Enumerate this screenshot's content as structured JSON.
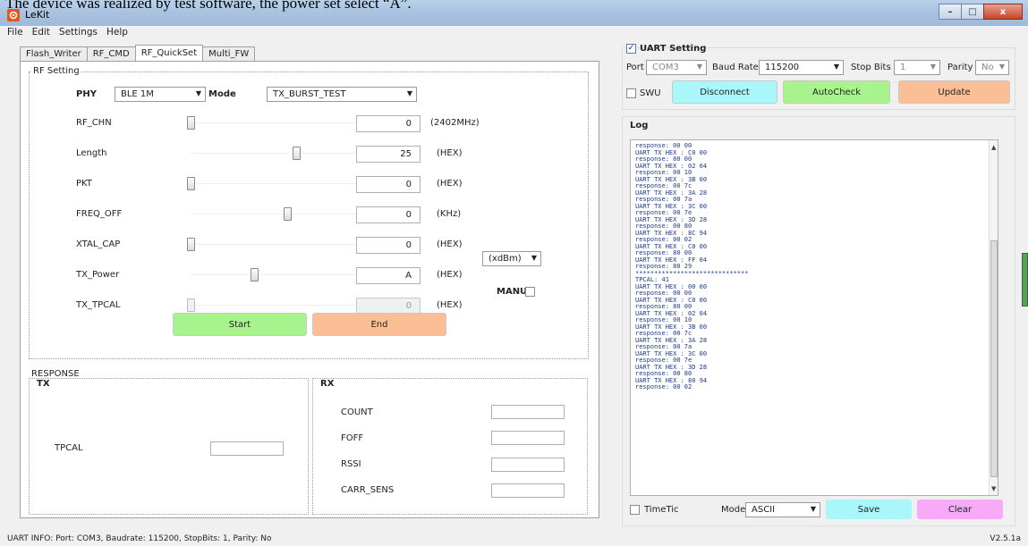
{
  "caption": "The device was realized by test software, the power set select “A”.",
  "window": {
    "title": "LeKit",
    "controls": [
      "–",
      "□",
      "x"
    ]
  },
  "menu": [
    "File",
    "Edit",
    "Settings",
    "Help"
  ],
  "tabs": [
    "Flash_Writer",
    "RF_CMD",
    "RF_QuickSet",
    "Multi_FW"
  ],
  "active_tab": "RF_QuickSet",
  "rf_setting": {
    "title": "RF Setting",
    "phy_label": "PHY",
    "phy_value": "BLE 1M",
    "mode_label": "Mode",
    "mode_value": "TX_BURST_TEST",
    "rows": [
      {
        "label": "RF_CHN",
        "value": "0",
        "unit": "(2402MHz)",
        "slider_fraction": 0.0,
        "disabled": false
      },
      {
        "label": "Length",
        "value": "25",
        "unit": "(HEX)",
        "slider_fraction": 0.55,
        "disabled": false
      },
      {
        "label": "PKT",
        "value": "0",
        "unit": "(HEX)",
        "slider_fraction": 0.0,
        "disabled": false
      },
      {
        "label": "FREQ_OFF",
        "value": "0",
        "unit": "(KHz)",
        "slider_fraction": 0.5,
        "disabled": false
      },
      {
        "label": "XTAL_CAP",
        "value": "0",
        "unit": "(HEX)",
        "slider_fraction": 0.0,
        "disabled": false
      },
      {
        "label": "TX_Power",
        "value": "A",
        "unit": "(HEX)",
        "slider_fraction": 0.33,
        "disabled": false
      },
      {
        "label": "TX_TPCAL",
        "value": "0",
        "unit": "(HEX)",
        "slider_fraction": 0.0,
        "disabled": true
      }
    ],
    "power_unit_select": "(xdBm)",
    "manu_label": "MANU",
    "start_label": "Start",
    "end_label": "End"
  },
  "response": {
    "title": "RESPONSE",
    "tx_title": "TX",
    "tx_tpcal_label": "TPCAL",
    "rx_title": "RX",
    "rx_fields": [
      "COUNT",
      "FOFF",
      "RSSI",
      "CARR_SENS"
    ]
  },
  "uart": {
    "title": "UART Setting",
    "checked": true,
    "port_label": "Port",
    "port_value": "COM3",
    "baud_label": "Baud Rate",
    "baud_value": "115200",
    "stop_label": "Stop Bits",
    "stop_value": "1",
    "parity_label": "Parity",
    "parity_value": "No",
    "swu_label": "SWU",
    "disconnect_label": "Disconnect",
    "autocheck_label": "AutoCheck",
    "update_label": "Update"
  },
  "log": {
    "title": "Log",
    "lines": [
      "response: 00 00",
      "UART TX HEX : C0 00",
      "response: 80 00",
      "UART TX HEX : 02 04",
      "response: 00 10",
      "UART TX HEX : 3B 00",
      "response: 00 7c",
      "UART TX HEX : 3A 28",
      "response: 00 7a",
      "UART TX HEX : 3C 00",
      "response: 00 7e",
      "UART TX HEX : 3D 28",
      "response: 00 80",
      "UART TX HEX : 8C 94",
      "response: 00 02",
      "UART TX HEX : C0 00",
      "response: 80 00",
      "UART TX HEX : FF 04",
      "response: 80 29",
      "******************************",
      "TPCAL: 41",
      "UART TX HEX : 00 00",
      "response: 00 00",
      "UART TX HEX : C0 00",
      "response: 80 00",
      "UART TX HEX : 02 04",
      "response: 00 10",
      "UART TX HEX : 3B 00",
      "response: 00 7c",
      "UART TX HEX : 3A 28",
      "response: 00 7a",
      "UART TX HEX : 3C 00",
      "response: 00 7e",
      "UART TX HEX : 3D 28",
      "response: 00 80",
      "UART TX HEX : 80 94",
      "response: 00 02"
    ],
    "timetic_label": "TimeTic",
    "mode_label": "Mode",
    "mode_value": "ASCII",
    "save_label": "Save",
    "clear_label": "Clear"
  },
  "status": {
    "uart_info": "UART INFO: Port: COM3, Baudrate: 115200, StopBits: 1, Parity: No",
    "version": "V2.5.1a"
  },
  "colors": {
    "green_button": "#a7f48f",
    "orange_button": "#fbbf95",
    "cyan_button": "#a9f6fb",
    "pink_button": "#f7aaf7",
    "log_text": "#1c3b8f"
  },
  "icons": {
    "app": "lekit-gear-icon",
    "dropdown": "chevron-down-icon"
  }
}
